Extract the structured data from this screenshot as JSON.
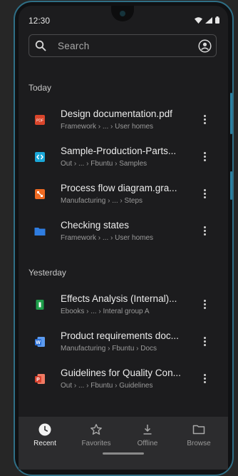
{
  "status_bar": {
    "time": "12:30"
  },
  "search": {
    "placeholder": "Search"
  },
  "sections": [
    {
      "title": "Today",
      "items": [
        {
          "name": "Design documentation.pdf",
          "path": "Framework › ... › User homes",
          "icon": "pdf-file-icon",
          "color": "#d9452b"
        },
        {
          "name": "Sample-Production-Parts...",
          "path": "Out › ... › Fbuntu › Samples",
          "icon": "code-file-icon",
          "color": "#1aa7d8"
        },
        {
          "name": "Process flow diagram.gra...",
          "path": "Manufacturing › ... › Steps",
          "icon": "diagram-file-icon",
          "color": "#ef6b23"
        },
        {
          "name": "Checking states",
          "path": "Framework › ... › User homes",
          "icon": "folder-icon",
          "color": "#2f7de1"
        }
      ]
    },
    {
      "title": "Yesterday",
      "items": [
        {
          "name": "Effects Analysis (Internal)...",
          "path": "Ebooks › ... › Interal group A",
          "icon": "spreadsheet-file-icon",
          "color": "#1e9e4a"
        },
        {
          "name": "Product requirements doc...",
          "path": "Manufacturing › Fbuntu › Docs",
          "icon": "word-file-icon",
          "color": "#2b6fd6"
        },
        {
          "name": "Guidelines for Quality Con...",
          "path": "Out › ... › Fbuntu › Guidelines",
          "icon": "presentation-file-icon",
          "color": "#d8412e"
        }
      ]
    }
  ],
  "bottom_nav": [
    {
      "label": "Recent",
      "icon": "clock-icon",
      "active": true
    },
    {
      "label": "Favorites",
      "icon": "star-icon",
      "active": false
    },
    {
      "label": "Offline",
      "icon": "download-icon",
      "active": false
    },
    {
      "label": "Browse",
      "icon": "folder-outline-icon",
      "active": false
    }
  ]
}
